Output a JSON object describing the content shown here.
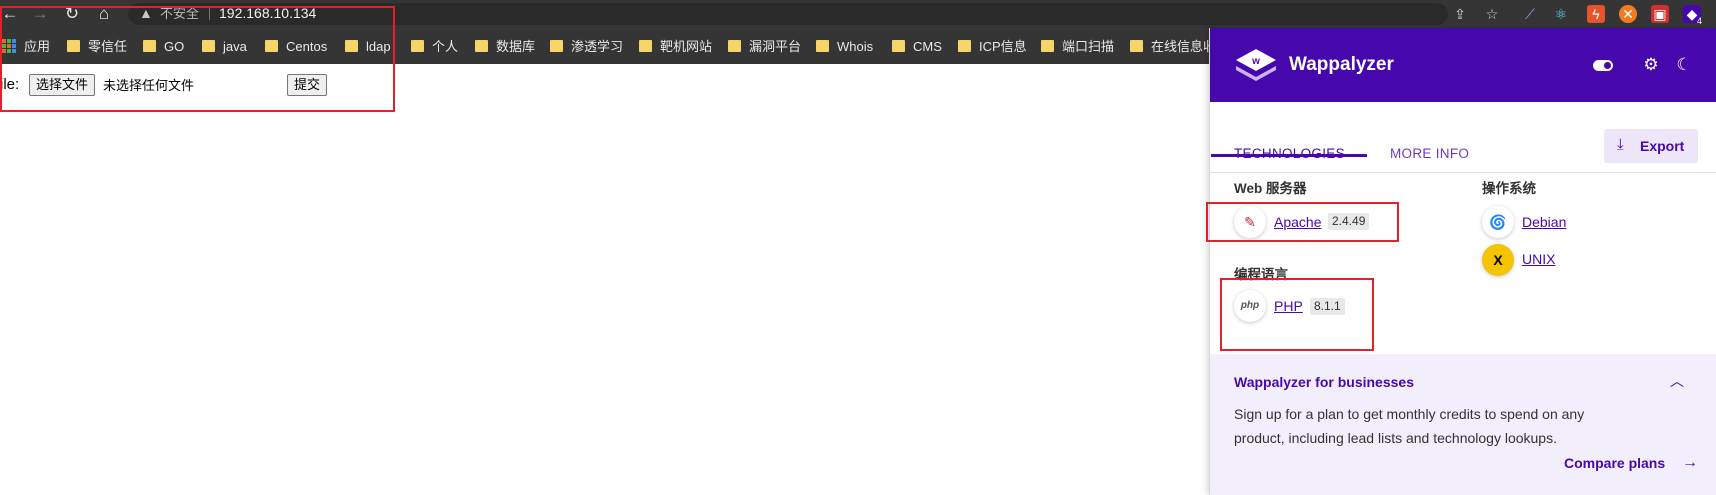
{
  "browser": {
    "insecure_label": "不安全",
    "url": "192.168.10.134",
    "extension_badge": "4"
  },
  "bookmarks": {
    "apps_label": "应用",
    "items": [
      "零信任",
      "GO",
      "java",
      "Centos",
      "ldap",
      "个人",
      "数据库",
      "渗透学习",
      "靶机网站",
      "漏洞平台",
      "Whois",
      "CMS",
      "ICP信息",
      "端口扫描",
      "在线信息收"
    ]
  },
  "page": {
    "file_label": "ile:",
    "choose_button": "选择文件",
    "no_file_text": "未选择任何文件",
    "submit_button": "提交"
  },
  "wappalyzer": {
    "title": "Wappalyzer",
    "tabs": [
      "TECHNOLOGIES",
      "MORE INFO"
    ],
    "export_label": "Export",
    "categories": [
      {
        "name": "Web 服务器",
        "techs": [
          {
            "name": "Apache",
            "version": "2.4.49"
          }
        ]
      },
      {
        "name": "编程语言",
        "techs": [
          {
            "name": "PHP",
            "version": "8.1.1",
            "icon_text": "php"
          }
        ]
      },
      {
        "name": "操作系统",
        "techs": [
          {
            "name": "Debian",
            "icon_text": "🌀"
          },
          {
            "name": "UNIX",
            "icon_text": "X"
          }
        ]
      }
    ],
    "business": {
      "title": "Wappalyzer for businesses",
      "text": "Sign up for a plan to get monthly credits to spend on any product, including lead lists and technology lookups.",
      "link": "Compare plans"
    }
  }
}
